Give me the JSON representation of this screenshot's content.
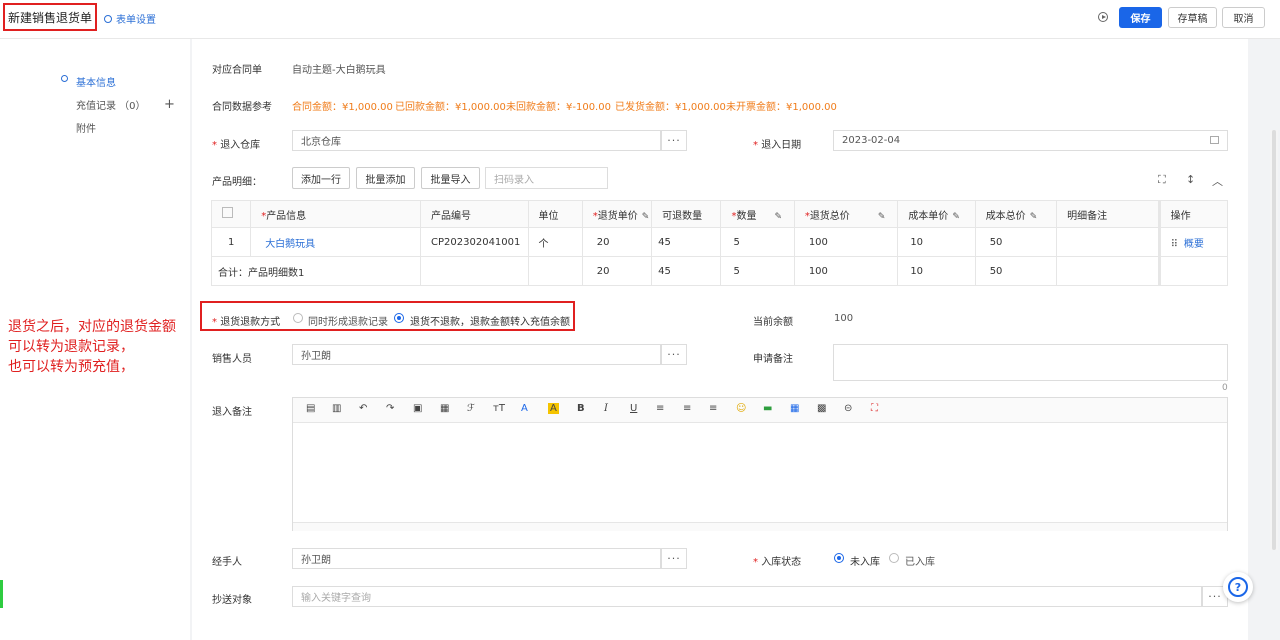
{
  "header": {
    "title": "新建销售退货单",
    "form_settings": "表单设置",
    "save": "保存",
    "draft": "存草稿",
    "cancel": "取消"
  },
  "sidebar": {
    "items": [
      {
        "label": "基本信息"
      },
      {
        "label": "充值记录 （0）"
      },
      {
        "label": "附件"
      }
    ]
  },
  "annotation": {
    "lines": [
      "退货之后，对应的退货金额",
      "可以转为退款记录，",
      "也可以转为预充值，"
    ]
  },
  "form": {
    "contract_label": "对应合同单",
    "contract_value": "自动主题-大白鹅玩具",
    "contract_ref_label": "合同数据参考",
    "contract_ref": {
      "amount": "合同金额：¥1,000.00",
      "received": "已回款金额：¥1,000.00",
      "unreceived": "未回款金额：¥-100.00",
      "shipped": "已发货金额：¥1,000.00",
      "uninvoiced": "未开票金额：¥1,000.00"
    },
    "warehouse_label": "退入仓库",
    "warehouse_value": "北京仓库",
    "date_label": "退入日期",
    "date_value": "2023-02-04",
    "products_label": "产品明细：",
    "add_row": "添加一行",
    "batch_add": "批量添加",
    "batch_import": "批量导入",
    "scan_placeholder": "扫码录入",
    "refund_method_label": "退货退款方式",
    "refund_option_1": "同时形成退款记录",
    "refund_option_2": "退货不退款，退款金额转入充值余额",
    "balance_label": "当前余额",
    "balance_value": "100",
    "sales_label": "销售人员",
    "sales_value": "孙卫朗",
    "apply_note_label": "申请备注",
    "apply_note_count": "0",
    "in_note_label": "退入备注",
    "handler_label": "经手人",
    "handler_value": "孙卫朗",
    "status_label": "入库状态",
    "status_option_1": "未入库",
    "status_option_2": "已入库",
    "cc_label": "抄送对象",
    "cc_placeholder": "输入关键字查询"
  },
  "table": {
    "headers": {
      "product": "产品信息",
      "code": "产品编号",
      "unit": "单位",
      "price": "退货单价",
      "returnable": "可退数量",
      "qty": "数量",
      "total": "退货总价",
      "cost_price": "成本单价",
      "cost_total": "成本总价",
      "note": "明细备注",
      "action": "操作"
    },
    "row": {
      "index": "1",
      "product": "大白鹅玩具",
      "code": "CP202302041001",
      "unit": "个",
      "price": "20",
      "returnable": "45",
      "qty": "5",
      "total": "100",
      "cost_price": "10",
      "cost_total": "50",
      "action": "概要"
    },
    "summary": {
      "label": "合计：产品明细数1",
      "price": "20",
      "returnable": "45",
      "qty": "5",
      "total": "100",
      "cost_price": "10",
      "cost_total": "50"
    }
  },
  "help_label": "?"
}
